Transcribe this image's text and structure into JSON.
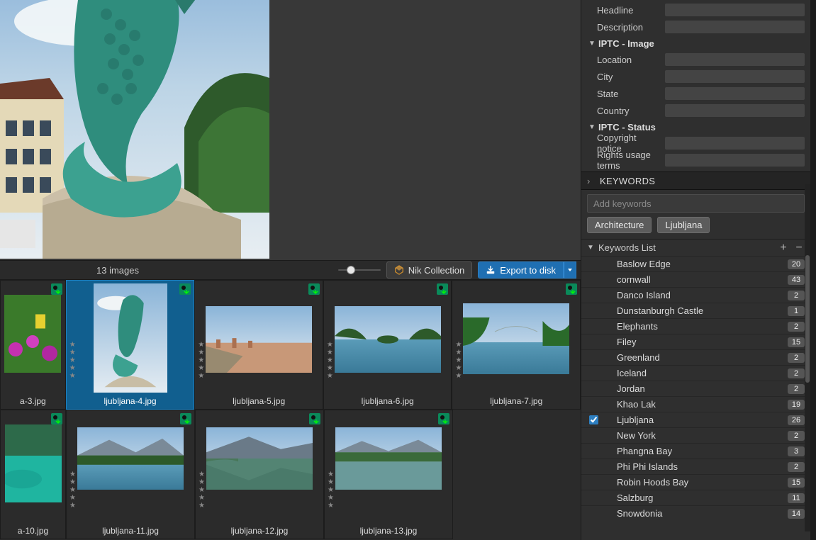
{
  "preview": {
    "alt": "Dragon statue preview"
  },
  "toolbar": {
    "image_count": "13 images",
    "nik_label": "Nik Collection",
    "export_label": "Export to disk"
  },
  "thumbs_row1": [
    {
      "label": "a-3.jpg",
      "partial": true,
      "selected": false,
      "scene": "flowers"
    },
    {
      "label": "ljubljana-4.jpg",
      "partial": false,
      "selected": true,
      "scene": "dragon"
    },
    {
      "label": "ljubljana-5.jpg",
      "partial": false,
      "selected": false,
      "scene": "cityscape"
    },
    {
      "label": "ljubljana-6.jpg",
      "partial": false,
      "selected": false,
      "scene": "lake-island"
    },
    {
      "label": "ljubljana-7.jpg",
      "partial": false,
      "selected": false,
      "scene": "lake-trees"
    }
  ],
  "thumbs_row2": [
    {
      "label": "a-10.jpg",
      "partial": true,
      "selected": false,
      "scene": "teal-water"
    },
    {
      "label": "ljubljana-11.jpg",
      "partial": false,
      "selected": false,
      "scene": "mountain-lake"
    },
    {
      "label": "ljubljana-12.jpg",
      "partial": false,
      "selected": false,
      "scene": "reflect-lake"
    },
    {
      "label": "ljubljana-13.jpg",
      "partial": false,
      "selected": false,
      "scene": "wide-lake"
    }
  ],
  "metadata": {
    "fields_top": [
      {
        "label": "Headline",
        "value": ""
      },
      {
        "label": "Description",
        "value": ""
      }
    ],
    "section_image": "IPTC - Image",
    "fields_image": [
      {
        "label": "Location",
        "value": ""
      },
      {
        "label": "City",
        "value": ""
      },
      {
        "label": "State",
        "value": ""
      },
      {
        "label": "Country",
        "value": ""
      }
    ],
    "section_status": "IPTC - Status",
    "fields_status": [
      {
        "label": "Copyright notice",
        "value": ""
      },
      {
        "label": "Rights usage terms",
        "value": ""
      }
    ]
  },
  "keywords_panel": {
    "title": "KEYWORDS",
    "placeholder": "Add keywords",
    "tags": [
      "Architecture",
      "Ljubljana"
    ],
    "list_title": "Keywords List",
    "items": [
      {
        "name": "Baslow Edge",
        "count": 20,
        "checked": false
      },
      {
        "name": "cornwall",
        "count": 43,
        "checked": false
      },
      {
        "name": "Danco Island",
        "count": 2,
        "checked": false
      },
      {
        "name": "Dunstanburgh Castle",
        "count": 1,
        "checked": false
      },
      {
        "name": "Elephants",
        "count": 2,
        "checked": false
      },
      {
        "name": "Filey",
        "count": 15,
        "checked": false
      },
      {
        "name": "Greenland",
        "count": 2,
        "checked": false
      },
      {
        "name": "Iceland",
        "count": 2,
        "checked": false
      },
      {
        "name": "Jordan",
        "count": 2,
        "checked": false
      },
      {
        "name": "Khao Lak",
        "count": 19,
        "checked": false
      },
      {
        "name": "Ljubljana",
        "count": 26,
        "checked": true
      },
      {
        "name": "New York",
        "count": 2,
        "checked": false
      },
      {
        "name": "Phangna Bay",
        "count": 3,
        "checked": false
      },
      {
        "name": "Phi Phi Islands",
        "count": 2,
        "checked": false
      },
      {
        "name": "Robin Hoods Bay",
        "count": 15,
        "checked": false
      },
      {
        "name": "Salzburg",
        "count": 11,
        "checked": false
      },
      {
        "name": "Snowdonia",
        "count": 14,
        "checked": false
      }
    ]
  }
}
